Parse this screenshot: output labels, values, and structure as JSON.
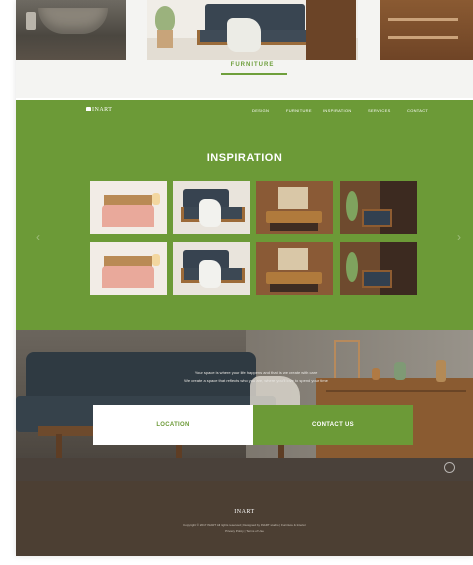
{
  "gallery": {
    "label": "FURNITURE",
    "accent_color": "#6e9f3c"
  },
  "nav": {
    "logo": "INART",
    "items": [
      "DESIGN",
      "FURNITURE",
      "INSPIRATION",
      "SERVICES",
      "CONTACT"
    ]
  },
  "inspiration": {
    "title": "INSPIRATION",
    "background_color": "#6c9a37",
    "prev_arrow": "‹",
    "next_arrow": "›"
  },
  "hero": {
    "line1": "Your space is where your life happens and that is we create with care",
    "line2": "We create a space that reflects who you are, where you'll love to spend your time",
    "location_button": "LOCATION",
    "contact_button": "CONTACT US"
  },
  "footer": {
    "logo": "INART",
    "line1": "Copyright © 2017 INART All rights reserved | Designed by INART studio | Furniture & Interior",
    "line2": "Privacy Policy | Terms of Use"
  }
}
